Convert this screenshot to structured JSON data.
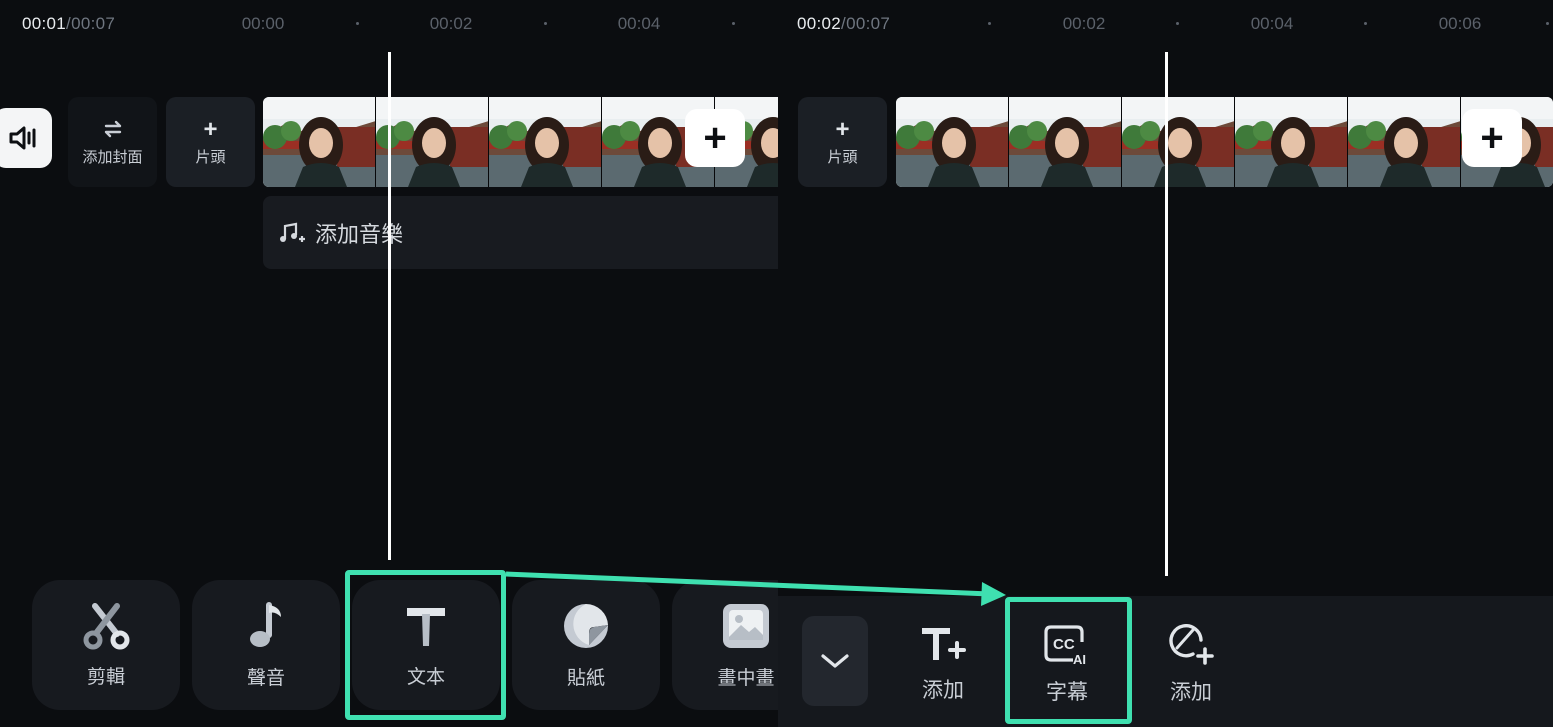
{
  "left": {
    "time": {
      "current": "00:01",
      "total": "/00:07"
    },
    "ruler": [
      "00:00",
      "00:02",
      "00:04"
    ],
    "cover_label": "添加封面",
    "intro_label": "片頭",
    "add_music_label": "添加音樂",
    "toolbar": [
      {
        "label": "剪輯",
        "icon": "scissors-icon"
      },
      {
        "label": "聲音",
        "icon": "music-note-icon"
      },
      {
        "label": "文本",
        "icon": "text-t-icon",
        "highlighted": true
      },
      {
        "label": "貼紙",
        "icon": "sticker-icon"
      },
      {
        "label": "畫中畫",
        "icon": "picture-in-picture-icon"
      }
    ]
  },
  "right": {
    "time": {
      "current": "00:02",
      "total": "/00:07"
    },
    "ruler": [
      "00:02",
      "00:04",
      "00:06"
    ],
    "intro_label": "片頭",
    "subtoolbar": [
      {
        "label": "添加",
        "icon": "add-text-icon"
      },
      {
        "label": "字幕",
        "icon": "cc-ai-icon",
        "highlighted": true
      },
      {
        "label": "添加",
        "icon": "add-shape-icon"
      }
    ]
  },
  "colors": {
    "background": "#0b0d10",
    "highlight": "#3fe0b0",
    "tile": "#1b1f25"
  }
}
